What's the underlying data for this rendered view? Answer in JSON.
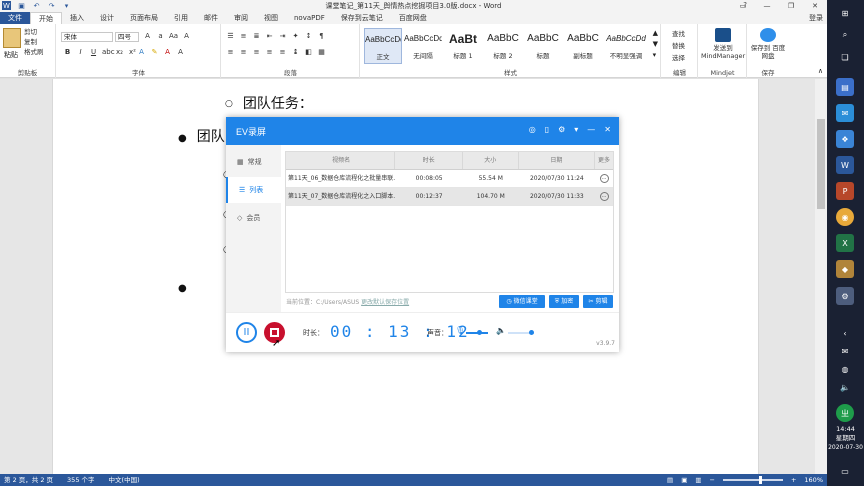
{
  "word": {
    "doc_title": "课堂笔记_第11天_舆情热点挖掘项目3.0版.docx - Word",
    "login": "登录",
    "tabs": [
      "文件",
      "开始",
      "插入",
      "设计",
      "页面布局",
      "引用",
      "邮件",
      "审阅",
      "视图",
      "novaPDF",
      "保存到云笔记",
      "百度网盘"
    ],
    "clipboard": {
      "paste": "粘贴",
      "cut": "剪切",
      "copy": "复制",
      "painter": "格式刷",
      "group": "剪贴板"
    },
    "font": {
      "name": "宋体",
      "size": "四号",
      "group": "字体"
    },
    "paragraph_group": "段落",
    "styles": {
      "group": "样式",
      "items": [
        {
          "sample": "AaBbCcDd",
          "name": "正文"
        },
        {
          "sample": "AaBbCcDd",
          "name": "无间隔"
        },
        {
          "sample": "AaBt",
          "name": "标题 1"
        },
        {
          "sample": "AaBbC",
          "name": "标题 2"
        },
        {
          "sample": "AaBbC",
          "name": "标题"
        },
        {
          "sample": "AaBbC",
          "name": "副标题"
        },
        {
          "sample": "AaBbCcDd",
          "name": "不明显强调"
        }
      ]
    },
    "editing": {
      "find": "查找",
      "replace": "替换",
      "select": "选择",
      "group": "编辑"
    },
    "mindjet": {
      "label": "发送到 MindManager",
      "group": "Mindjet"
    },
    "baidu_save": {
      "label": "保存到 百度网盘",
      "group": "保存"
    },
    "doc_lines": [
      "团队任务：",
      "团队"
    ],
    "status": {
      "page": "第 2 页，共 2 页",
      "words": "355 个字",
      "lang": "中文(中国)",
      "zoom": "160%"
    }
  },
  "ev": {
    "title": "EV录屏",
    "nav": [
      "常规",
      "列表",
      "会员"
    ],
    "columns": [
      "视频名",
      "时长",
      "大小",
      "日期",
      "更多"
    ],
    "rows": [
      {
        "name": "第11天_06_数据仓库流程化之批量串联...",
        "duration": "00:08:05",
        "size": "55.54 M",
        "date": "2020/07/30 11:24",
        "more": "…"
      },
      {
        "name": "第11天_07_数据仓库流程化之入口脚本...",
        "duration": "00:12:37",
        "size": "104.70 M",
        "date": "2020/07/30 11:33",
        "more": "…"
      }
    ],
    "path_label": "当前位置：C:/Users/ASUS",
    "path_link": "更改默认保存位置",
    "buttons": [
      "微信课堂",
      "加密",
      "剪辑"
    ],
    "pause": "II",
    "duration_label": "时长：",
    "timer": "00 : 13 : 12",
    "sound_label": "声音：",
    "mic_level": 0.6,
    "speaker_level": 0.9,
    "version": "v3.9.7"
  },
  "taskbar": {
    "time": "14:44",
    "weekday": "星期四",
    "date": "2020-07-30"
  },
  "colors": {
    "word_blue": "#2b579a",
    "ev_blue": "#1f84e8",
    "stop_red": "#c8102e"
  }
}
